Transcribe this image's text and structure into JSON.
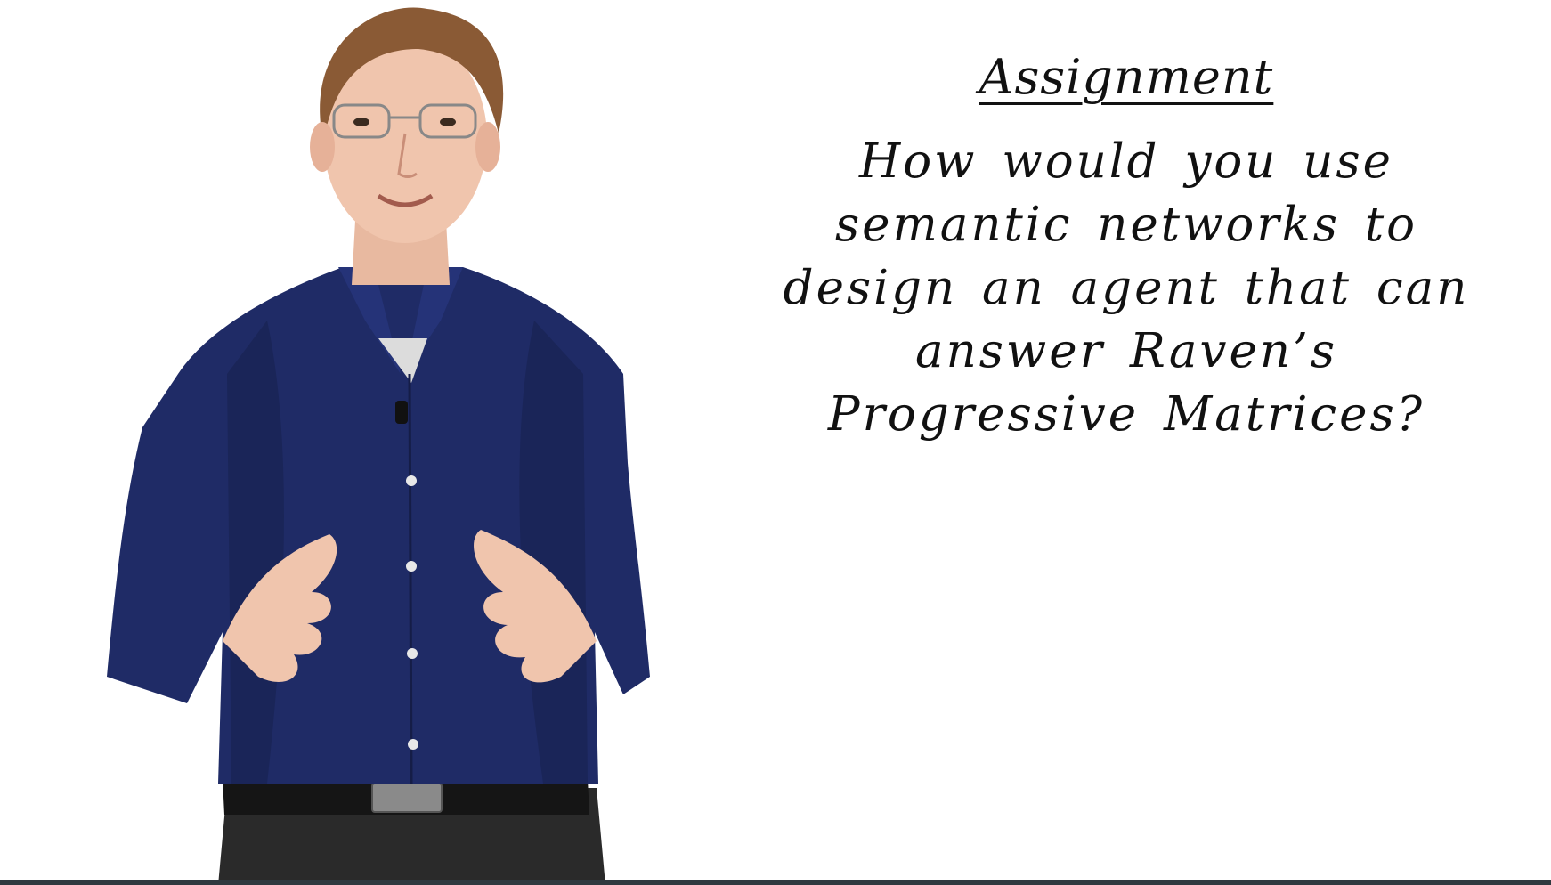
{
  "slide": {
    "title": "Assignment",
    "question": "How would you use semantic networks to design an agent that can answer Raven’s Progressive Matrices?"
  },
  "presenter": {
    "image": "man-in-blue-shirt-gesturing"
  },
  "colors": {
    "background": "#ffffff",
    "text": "#111111",
    "shirt": "#1f2b66",
    "bottom_bar": "#2f3a40"
  }
}
